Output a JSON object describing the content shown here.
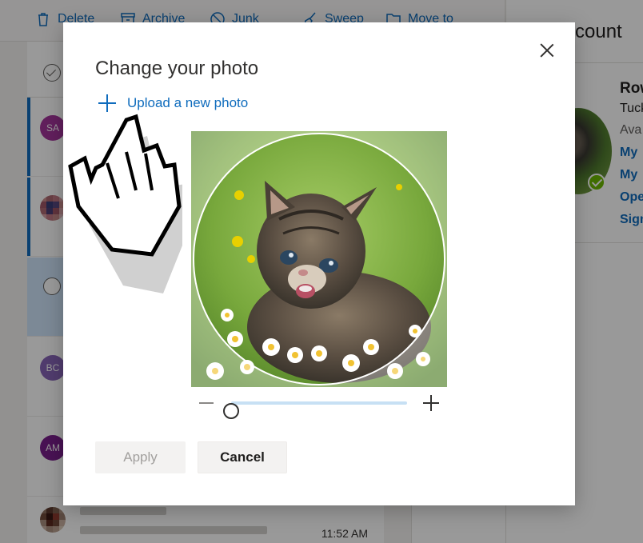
{
  "toolbar": {
    "items": [
      {
        "label": "Delete",
        "icon": "trash-icon"
      },
      {
        "label": "Archive",
        "icon": "archive-icon"
      },
      {
        "label": "Junk",
        "icon": "junk-icon"
      },
      {
        "label": "Sweep",
        "icon": "sweep-icon"
      },
      {
        "label": "Move to",
        "icon": "folder-move-icon"
      }
    ]
  },
  "mail_list": {
    "rows": [
      {
        "initials": "SA",
        "color": "#a4349b"
      },
      {
        "initials": "",
        "color": ""
      },
      {
        "initials": "",
        "color": ""
      },
      {
        "initials": "BC",
        "color": "#8764b8"
      },
      {
        "initials": "AM",
        "color": "#7a1f8c"
      }
    ],
    "last_time": "11:52 AM"
  },
  "account_panel": {
    "title": "count",
    "name": "Row",
    "sub": "Tuck",
    "status": "Ava",
    "links": [
      "My",
      "My",
      "Ope",
      "Sign"
    ]
  },
  "dialog": {
    "title": "Change your photo",
    "upload_label": "Upload a new photo",
    "zoom_level": 0.0,
    "apply_label": "Apply",
    "cancel_label": "Cancel"
  },
  "colors": {
    "accent": "#0f6cbd",
    "presence": "#6bb700"
  }
}
